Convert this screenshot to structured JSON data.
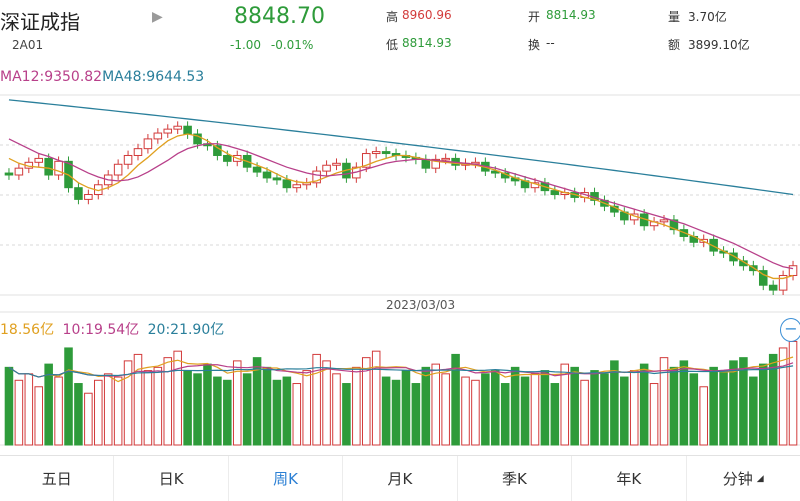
{
  "header": {
    "name": "深证成指",
    "code": "2A01",
    "play_icon": "play-triangle-icon",
    "price": "8848.70",
    "change": "-1.00",
    "change_pct": "-0.01%",
    "stats": {
      "high_label": "高",
      "high_value": "8960.96",
      "open_label": "开",
      "open_value": "8814.93",
      "volume_label": "量",
      "volume_value": "3.70亿",
      "low_label": "低",
      "low_value": "8814.93",
      "turnover_label": "换",
      "turnover_value": "--",
      "amount_label": "额",
      "amount_value": "3899.10亿"
    }
  },
  "colors": {
    "up": "#d23a3a",
    "down": "#2e9b3a",
    "ma5": "#e0a020",
    "ma12": "#b8408a",
    "ma48": "#2a7f9b",
    "active_tab": "#2a7fd4"
  },
  "ma_legend": {
    "ma12": "MA12:9350.82",
    "ma48": "MA48:9644.53"
  },
  "volume_legend": {
    "vma5": "18.56亿",
    "vma10": "10:19.54亿",
    "vma20": "20:21.90亿"
  },
  "date_label": "2023/03/03",
  "tabs": [
    {
      "label": "五日"
    },
    {
      "label": "日K"
    },
    {
      "label": "周K"
    },
    {
      "label": "月K"
    },
    {
      "label": "季K"
    },
    {
      "label": "年K"
    },
    {
      "label": "分钟"
    }
  ],
  "active_tab": 2,
  "chart_data": {
    "type": "candlestick",
    "period": "weekly",
    "candles_open": [
      9.2,
      9.18,
      9.25,
      9.31,
      9.35,
      9.18,
      9.32,
      9.05,
      8.93,
      8.98,
      9.08,
      9.18,
      9.29,
      9.38,
      9.45,
      9.55,
      9.61,
      9.65,
      9.68,
      9.6,
      9.5,
      9.48,
      9.38,
      9.32,
      9.38,
      9.26,
      9.21,
      9.15,
      9.13,
      9.05,
      9.08,
      9.1,
      9.22,
      9.28,
      9.3,
      9.15,
      9.26,
      9.4,
      9.42,
      9.4,
      9.38,
      9.36,
      9.34,
      9.25,
      9.34,
      9.35,
      9.28,
      9.3,
      9.31,
      9.22,
      9.2,
      9.15,
      9.12,
      9.05,
      9.1,
      9.02,
      8.98,
      9.0,
      8.95,
      9.0,
      8.92,
      8.86,
      8.8,
      8.72,
      8.78,
      8.66,
      8.7,
      8.72,
      8.62,
      8.55,
      8.49,
      8.52,
      8.4,
      8.38,
      8.3,
      8.25,
      8.2,
      8.05,
      8.0,
      8.15
    ],
    "candles_close": [
      9.18,
      9.25,
      9.31,
      9.35,
      9.18,
      9.32,
      9.05,
      8.93,
      8.98,
      9.08,
      9.18,
      9.29,
      9.38,
      9.45,
      9.55,
      9.61,
      9.65,
      9.68,
      9.6,
      9.5,
      9.48,
      9.38,
      9.32,
      9.38,
      9.26,
      9.21,
      9.15,
      9.13,
      9.05,
      9.08,
      9.1,
      9.22,
      9.28,
      9.3,
      9.15,
      9.26,
      9.4,
      9.42,
      9.4,
      9.38,
      9.36,
      9.34,
      9.25,
      9.34,
      9.35,
      9.28,
      9.3,
      9.31,
      9.22,
      9.2,
      9.15,
      9.12,
      9.05,
      9.1,
      9.02,
      8.98,
      9.0,
      8.95,
      9.0,
      8.92,
      8.86,
      8.8,
      8.72,
      8.78,
      8.66,
      8.7,
      8.72,
      8.62,
      8.55,
      8.49,
      8.52,
      8.4,
      8.38,
      8.3,
      8.25,
      8.2,
      8.05,
      8.0,
      8.15,
      8.25
    ],
    "ma5": [
      9.35,
      9.3,
      9.27,
      9.26,
      9.25,
      9.22,
      9.18,
      9.1,
      9.05,
      9.02,
      9.05,
      9.1,
      9.18,
      9.28,
      9.36,
      9.45,
      9.53,
      9.58,
      9.6,
      9.58,
      9.53,
      9.46,
      9.4,
      9.35,
      9.32,
      9.28,
      9.24,
      9.19,
      9.14,
      9.11,
      9.1,
      9.12,
      9.16,
      9.2,
      9.23,
      9.25,
      9.28,
      9.32,
      9.35,
      9.38,
      9.38,
      9.36,
      9.34,
      9.32,
      9.31,
      9.3,
      9.29,
      9.28,
      9.26,
      9.23,
      9.19,
      9.15,
      9.12,
      9.09,
      9.06,
      9.03,
      9.0,
      8.98,
      8.95,
      8.93,
      8.89,
      8.85,
      8.8,
      8.76,
      8.73,
      8.7,
      8.67,
      8.63,
      8.59,
      8.55,
      8.5,
      8.45,
      8.4,
      8.35,
      8.29,
      8.23,
      8.16,
      8.12,
      8.12,
      8.15
    ],
    "ma12": [
      9.55,
      9.5,
      9.45,
      9.4,
      9.37,
      9.33,
      9.3,
      9.25,
      9.2,
      9.16,
      9.13,
      9.12,
      9.13,
      9.16,
      9.21,
      9.27,
      9.33,
      9.4,
      9.45,
      9.48,
      9.5,
      9.5,
      9.48,
      9.45,
      9.42,
      9.38,
      9.34,
      9.3,
      9.26,
      9.23,
      9.2,
      9.18,
      9.17,
      9.18,
      9.19,
      9.21,
      9.24,
      9.27,
      9.3,
      9.32,
      9.33,
      9.34,
      9.34,
      9.33,
      9.32,
      9.31,
      9.3,
      9.29,
      9.27,
      9.25,
      9.22,
      9.19,
      9.16,
      9.13,
      9.1,
      9.07,
      9.04,
      9.01,
      8.98,
      8.95,
      8.92,
      8.89,
      8.86,
      8.83,
      8.8,
      8.77,
      8.74,
      8.71,
      8.68,
      8.64,
      8.6,
      8.56,
      8.52,
      8.48,
      8.43,
      8.38,
      8.33,
      8.28,
      8.24,
      8.22
    ],
    "ma48_start": 9.95,
    "ma48_end": 8.98,
    "volumes": [
      24,
      20,
      22,
      18,
      25,
      21,
      30,
      19,
      16,
      20,
      22,
      21,
      26,
      28,
      23,
      24,
      27,
      29,
      23,
      22,
      25,
      21,
      20,
      26,
      22,
      27,
      24,
      20,
      21,
      19,
      23,
      28,
      26,
      22,
      19,
      24,
      27,
      29,
      21,
      20,
      23,
      19,
      24,
      25,
      22,
      28,
      21,
      20,
      22,
      23,
      19,
      24,
      21,
      22,
      23,
      19,
      25,
      24,
      20,
      23,
      22,
      26,
      21,
      23,
      25,
      19,
      27,
      24,
      26,
      22,
      18,
      24,
      23,
      26,
      27,
      21,
      25,
      28,
      30,
      32
    ],
    "volume_up": [
      0,
      1,
      1,
      1,
      0,
      1,
      0,
      0,
      1,
      1,
      1,
      1,
      1,
      1,
      1,
      1,
      1,
      1,
      0,
      0,
      0,
      0,
      0,
      1,
      0,
      0,
      0,
      0,
      0,
      1,
      1,
      1,
      1,
      1,
      0,
      1,
      1,
      1,
      0,
      0,
      0,
      0,
      0,
      1,
      1,
      0,
      1,
      1,
      0,
      0,
      0,
      0,
      0,
      1,
      0,
      0,
      1,
      0,
      1,
      0,
      0,
      0,
      0,
      1,
      0,
      1,
      1,
      0,
      0,
      0,
      1,
      0,
      0,
      0,
      0,
      0,
      0,
      0,
      1,
      1
    ]
  }
}
